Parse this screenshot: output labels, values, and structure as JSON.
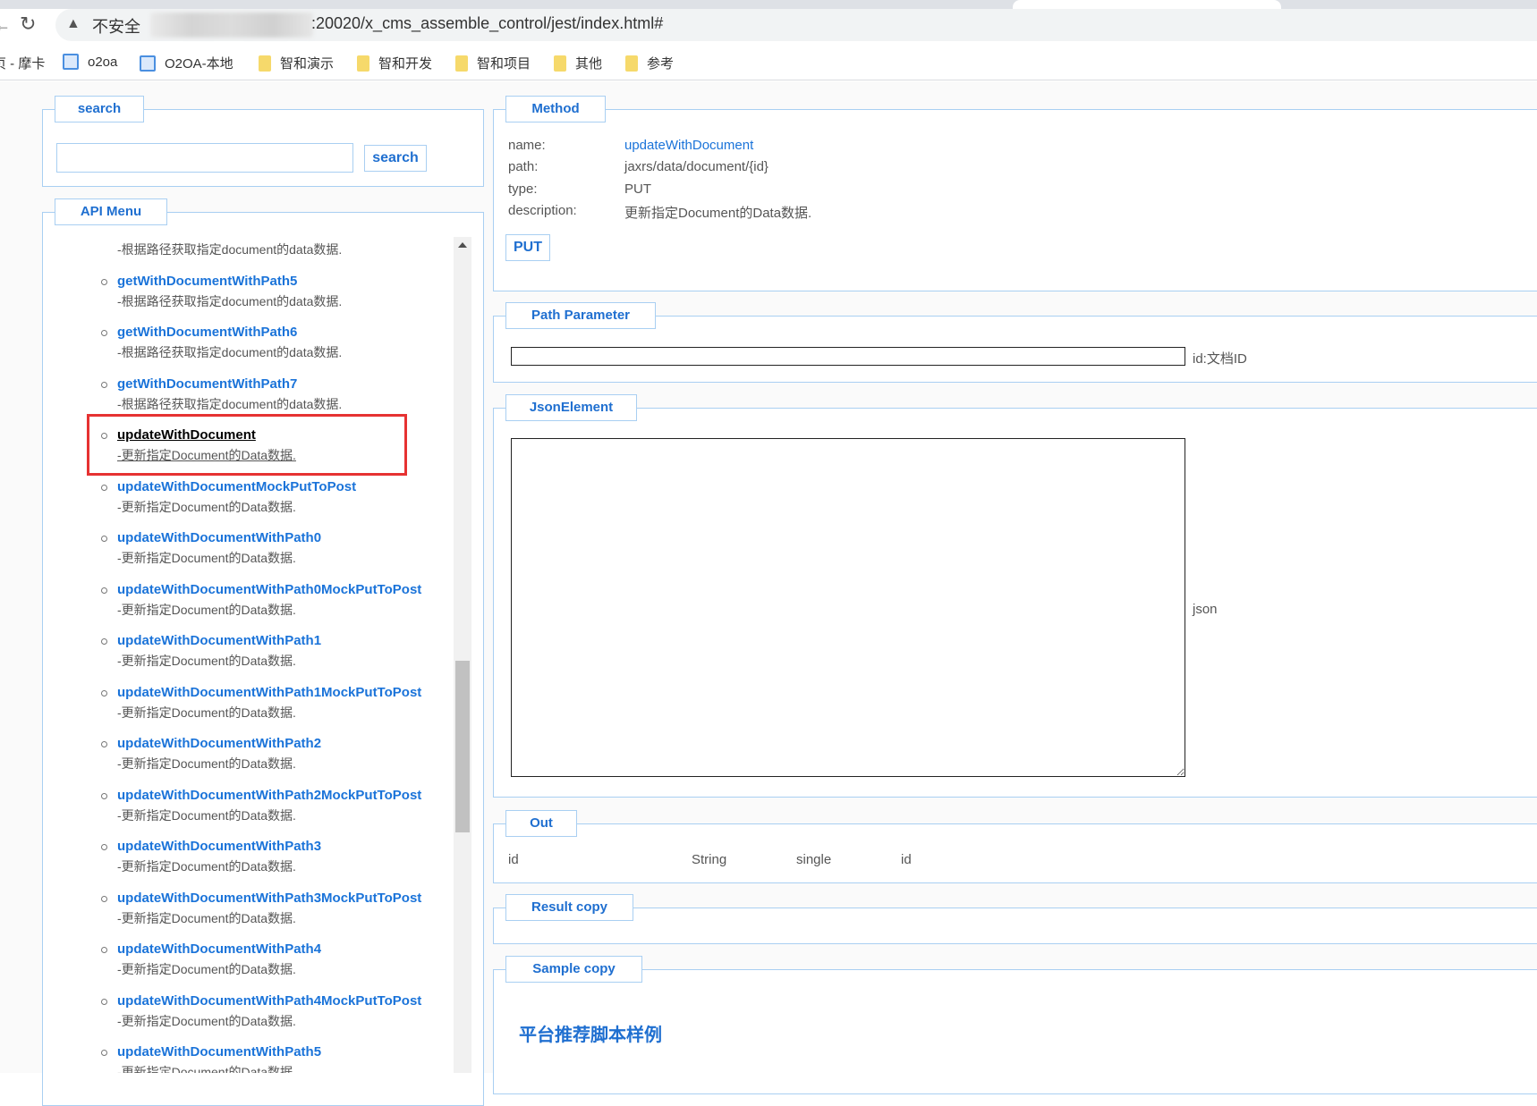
{
  "browser": {
    "security_label": "不安全",
    "url_visible": ":20020/x_cms_assemble_control/jest/index.html#",
    "bookmarks": [
      {
        "label": "页 - 摩卡",
        "icon": "none"
      },
      {
        "label": "o2oa",
        "icon": "site-icon"
      },
      {
        "label": "O2OA-本地",
        "icon": "site-icon"
      },
      {
        "label": "智和演示",
        "icon": "folder-icon"
      },
      {
        "label": "智和开发",
        "icon": "folder-icon"
      },
      {
        "label": "智和项目",
        "icon": "folder-icon"
      },
      {
        "label": "其他",
        "icon": "folder-icon"
      },
      {
        "label": "参考",
        "icon": "folder-icon"
      }
    ]
  },
  "search": {
    "legend": "search",
    "input_value": "",
    "button_label": "search"
  },
  "api_menu": {
    "legend": "API Menu",
    "selected_index": 4,
    "items": [
      {
        "name": "",
        "desc": "-根据路径获取指定document的data数据."
      },
      {
        "name": "getWithDocumentWithPath5",
        "desc": "-根据路径获取指定document的data数据."
      },
      {
        "name": "getWithDocumentWithPath6",
        "desc": "-根据路径获取指定document的data数据."
      },
      {
        "name": "getWithDocumentWithPath7",
        "desc": "-根据路径获取指定document的data数据."
      },
      {
        "name": "updateWithDocument",
        "desc": "-更新指定Document的Data数据."
      },
      {
        "name": "updateWithDocumentMockPutToPost",
        "desc": "-更新指定Document的Data数据."
      },
      {
        "name": "updateWithDocumentWithPath0",
        "desc": "-更新指定Document的Data数据."
      },
      {
        "name": "updateWithDocumentWithPath0MockPutToPost",
        "desc": "-更新指定Document的Data数据."
      },
      {
        "name": "updateWithDocumentWithPath1",
        "desc": "-更新指定Document的Data数据."
      },
      {
        "name": "updateWithDocumentWithPath1MockPutToPost",
        "desc": "-更新指定Document的Data数据."
      },
      {
        "name": "updateWithDocumentWithPath2",
        "desc": "-更新指定Document的Data数据."
      },
      {
        "name": "updateWithDocumentWithPath2MockPutToPost",
        "desc": "-更新指定Document的Data数据."
      },
      {
        "name": "updateWithDocumentWithPath3",
        "desc": "-更新指定Document的Data数据."
      },
      {
        "name": "updateWithDocumentWithPath3MockPutToPost",
        "desc": "-更新指定Document的Data数据."
      },
      {
        "name": "updateWithDocumentWithPath4",
        "desc": "-更新指定Document的Data数据."
      },
      {
        "name": "updateWithDocumentWithPath4MockPutToPost",
        "desc": "-更新指定Document的Data数据."
      },
      {
        "name": "updateWithDocumentWithPath5",
        "desc": "-更新指定Document的Data数据."
      }
    ]
  },
  "method": {
    "legend": "Method",
    "name_label": "name:",
    "name_value": "updateWithDocument",
    "path_label": "path:",
    "path_value": "jaxrs/data/document/{id}",
    "type_label": "type:",
    "type_value": "PUT",
    "desc_label": "description:",
    "desc_value": "更新指定Document的Data数据.",
    "button_label": "PUT"
  },
  "path_parameter": {
    "legend": "Path Parameter",
    "input_value": "",
    "label": "id:文档ID"
  },
  "json_element": {
    "legend": "JsonElement",
    "textarea_value": "",
    "label": "json"
  },
  "out": {
    "legend": "Out",
    "row": [
      "id",
      "String",
      "single",
      "id"
    ]
  },
  "result": {
    "legend": "Result copy"
  },
  "sample": {
    "legend": "Sample copy",
    "heading": "平台推荐脚本样例"
  },
  "colors": {
    "accent": "#1f6fd0",
    "border": "#a9cff2",
    "highlight": "#e63232"
  }
}
